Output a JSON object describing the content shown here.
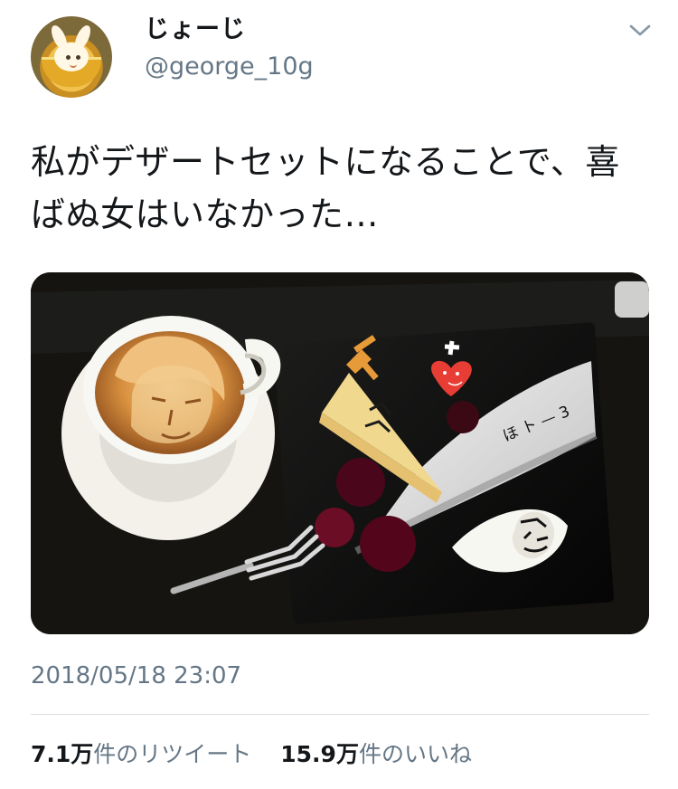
{
  "user": {
    "display_name": "じょーじ",
    "handle": "@george_10g",
    "avatar_icon": "bunny-latte-avatar"
  },
  "menu": {
    "icon": "chevron-down-icon"
  },
  "tweet": {
    "text": "私がデザートセットになることで、喜ばぬ女はいなかった…",
    "timestamp": "2018/05/18 23:07"
  },
  "stats": {
    "retweets": {
      "count": "7.1万",
      "label": "件のリツイート"
    },
    "likes": {
      "count": "15.9万",
      "label": "件のいいね"
    }
  },
  "colors": {
    "text": "#14171a",
    "secondary": "#657786",
    "background": "#ffffff",
    "divider": "#d8dde2"
  }
}
